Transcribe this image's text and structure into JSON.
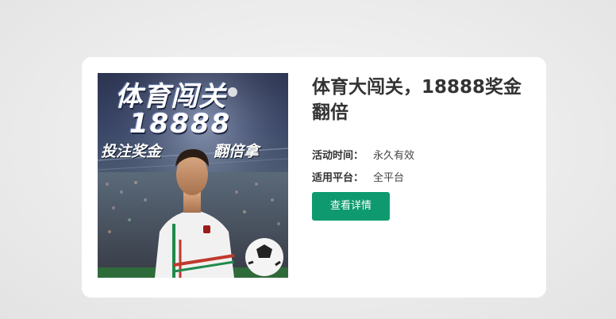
{
  "promo": {
    "banner": {
      "title": "体育闯关",
      "number": "18888",
      "subtitle_left": "投注奖金",
      "subtitle_right": "翻倍拿"
    },
    "title": "体育大闯关，18888奖金翻倍",
    "details": [
      {
        "label": "活动时间：",
        "value": "永久有效"
      },
      {
        "label": "适用平台：",
        "value": "全平台"
      }
    ],
    "button_label": "查看详情"
  },
  "colors": {
    "button": "#0e9a6e",
    "card": "#ffffff",
    "page_background": "#ececec"
  }
}
